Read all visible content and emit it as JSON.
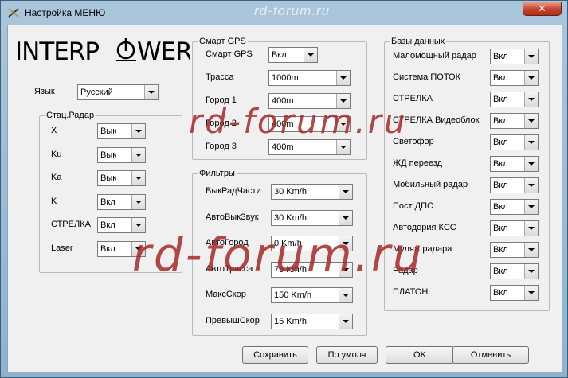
{
  "window": {
    "title": "Настройка МЕНЮ",
    "watermark_top": "rd-forum.ru",
    "close_glyph": "✕"
  },
  "logo": {
    "text": "INTERPOWER",
    "icon": "interpower-logo-icon"
  },
  "language": {
    "label": "Язык",
    "value": "Русский"
  },
  "stat_radar": {
    "title": "Стац.Радар",
    "rows": [
      {
        "label": "X",
        "value": "Вык"
      },
      {
        "label": "Ku",
        "value": "Вык"
      },
      {
        "label": "Ka",
        "value": "Вык"
      },
      {
        "label": "K",
        "value": "Вкл"
      },
      {
        "label": "СТРЕЛКА",
        "value": "Вкл"
      },
      {
        "label": "Laser",
        "value": "Вкл"
      }
    ]
  },
  "smart_gps": {
    "title": "Смарт GPS",
    "rows": [
      {
        "label": "Смарт GPS",
        "value": "Вкл"
      },
      {
        "label": "Трасса",
        "value": "1000m"
      },
      {
        "label": "Город 1",
        "value": "400m"
      },
      {
        "label": "Город 2",
        "value": "400m"
      },
      {
        "label": "Город 3",
        "value": "400m"
      }
    ]
  },
  "filters": {
    "title": "Фильтры",
    "rows": [
      {
        "label": "ВыкРадЧасти",
        "value": "30 Km/h"
      },
      {
        "label": "АвтоВыкЗвук",
        "value": "30 Km/h"
      },
      {
        "label": "АвтоГород",
        "value": "0 Km/h"
      },
      {
        "label": "АвтоТрасса",
        "value": "75 Km/h"
      },
      {
        "label": "МаксСкор",
        "value": "150 Km/h"
      },
      {
        "label": "ПревышСкор",
        "value": "15 Km/h"
      }
    ]
  },
  "databases": {
    "title": "Базы данных",
    "rows": [
      {
        "label": "Маломощный радар",
        "value": "Вкл"
      },
      {
        "label": "Система ПОТОК",
        "value": "Вкл"
      },
      {
        "label": "СТРЕЛКА",
        "value": "Вкл"
      },
      {
        "label": "СТРЕЛКА Видеоблок",
        "value": "Вкл"
      },
      {
        "label": "Светофор",
        "value": "Вкл"
      },
      {
        "label": "ЖД переезд",
        "value": "Вкл"
      },
      {
        "label": "Мобильный радар",
        "value": "Вкл"
      },
      {
        "label": "Пост ДПС",
        "value": "Вкл"
      },
      {
        "label": "Автодория КСС",
        "value": "Вкл"
      },
      {
        "label": "Муляж радара",
        "value": "Вкл"
      },
      {
        "label": "Радар",
        "value": "Вкл"
      },
      {
        "label": "ПЛАТОН",
        "value": "Вкл"
      }
    ]
  },
  "buttons": {
    "save": "Сохранить",
    "default": "По умолч",
    "ok": "OK",
    "cancel": "Отменить"
  },
  "watermark": {
    "text": "rd-forum.ru"
  }
}
